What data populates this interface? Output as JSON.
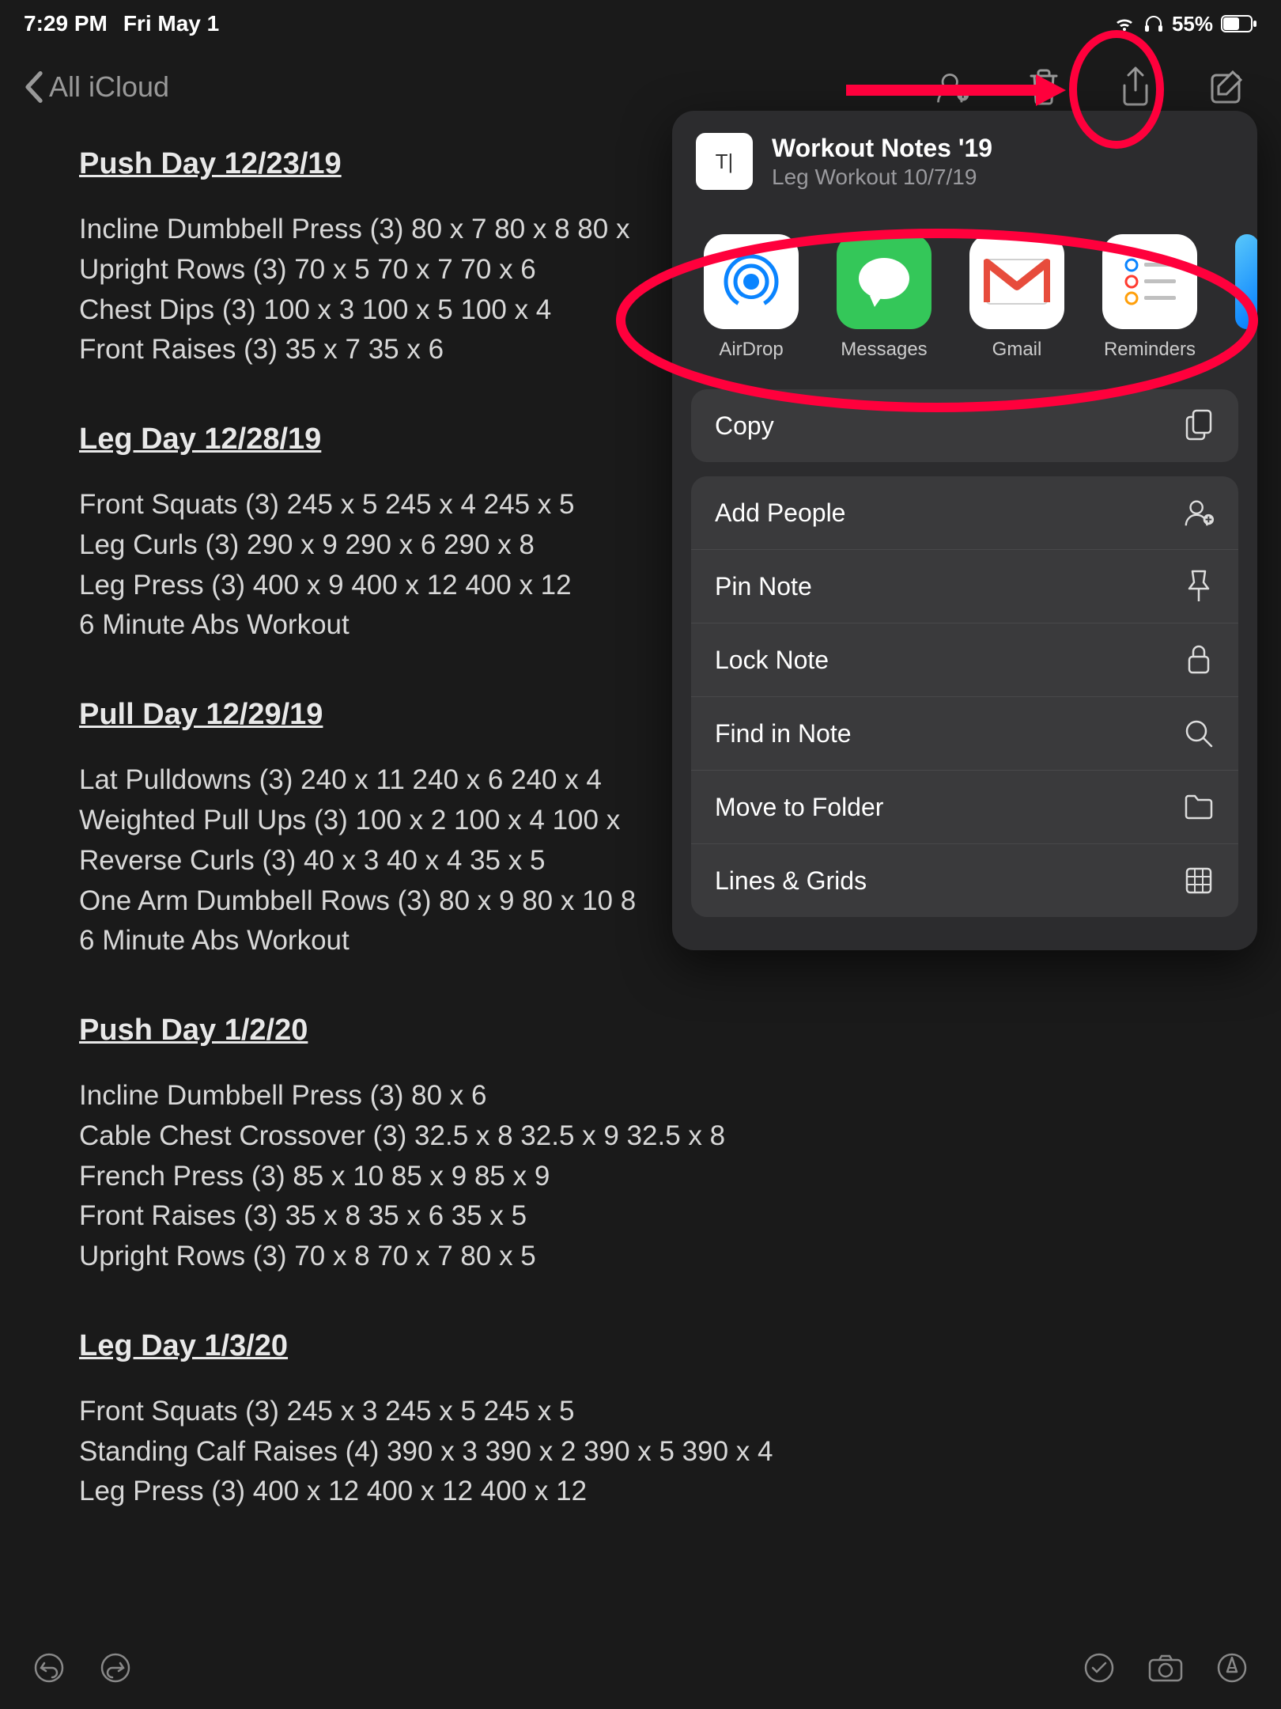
{
  "status": {
    "time": "7:29 PM",
    "date": "Fri May 1",
    "battery": "55%"
  },
  "nav": {
    "back_label": "All iCloud"
  },
  "note": {
    "s1_title": "Push Day 12/23/19",
    "s1_l1": "Incline Dumbbell Press (3) 80 x 7 80 x 8 80 x",
    "s1_l2": "Upright Rows (3) 70 x 5 70 x 7 70 x 6",
    "s1_l3": "Chest Dips (3) 100 x 3 100 x 5 100 x 4",
    "s1_l4": "Front Raises (3) 35 x 7 35 x 6",
    "s2_title": "Leg Day 12/28/19",
    "s2_l1": "Front Squats (3) 245 x 5 245 x 4 245 x 5",
    "s2_l2": "Leg Curls (3) 290 x 9 290 x 6 290 x 8",
    "s2_l3": "Leg Press (3) 400 x 9 400 x 12 400 x 12",
    "s2_l4": "6 Minute Abs Workout",
    "s3_title": "Pull Day 12/29/19",
    "s3_l1": "Lat Pulldowns (3) 240 x 11 240 x 6 240 x 4",
    "s3_l2": "Weighted Pull Ups (3) 100 x 2 100 x 4 100 x",
    "s3_l3": "Reverse Curls (3) 40 x 3 40 x 4 35 x 5",
    "s3_l4": "One Arm Dumbbell Rows (3) 80 x 9 80 x 10 8",
    "s3_l5": "6 Minute Abs Workout",
    "s4_title": "Push Day 1/2/20",
    "s4_l1": "Incline Dumbbell Press (3) 80 x 6",
    "s4_l2": "Cable Chest Crossover (3) 32.5 x 8 32.5 x 9 32.5 x 8",
    "s4_l3": "French Press (3) 85 x 10 85 x 9 85 x 9",
    "s4_l4": "Front Raises (3) 35 x 8 35 x 6 35 x 5",
    "s4_l5": "Upright Rows (3) 70 x 8 70 x 7 80 x 5",
    "s5_title": "Leg Day 1/3/20",
    "s5_l1": "Front Squats (3) 245 x 3 245 x 5 245 x 5",
    "s5_l2": "Standing Calf Raises (4) 390 x 3 390 x 2 390 x 5 390 x 4",
    "s5_l3": "Leg Press (3) 400 x 12 400 x 12 400 x 12"
  },
  "share": {
    "thumb_glyph": "T|",
    "title": "Workout Notes '19",
    "subtitle": "Leg Workout 10/7/19",
    "apps": {
      "airdrop": "AirDrop",
      "messages": "Messages",
      "gmail": "Gmail",
      "reminders": "Reminders"
    },
    "actions": {
      "copy": "Copy",
      "add_people": "Add People",
      "pin": "Pin Note",
      "lock": "Lock Note",
      "find": "Find in Note",
      "move": "Move to Folder",
      "lines": "Lines & Grids"
    }
  }
}
